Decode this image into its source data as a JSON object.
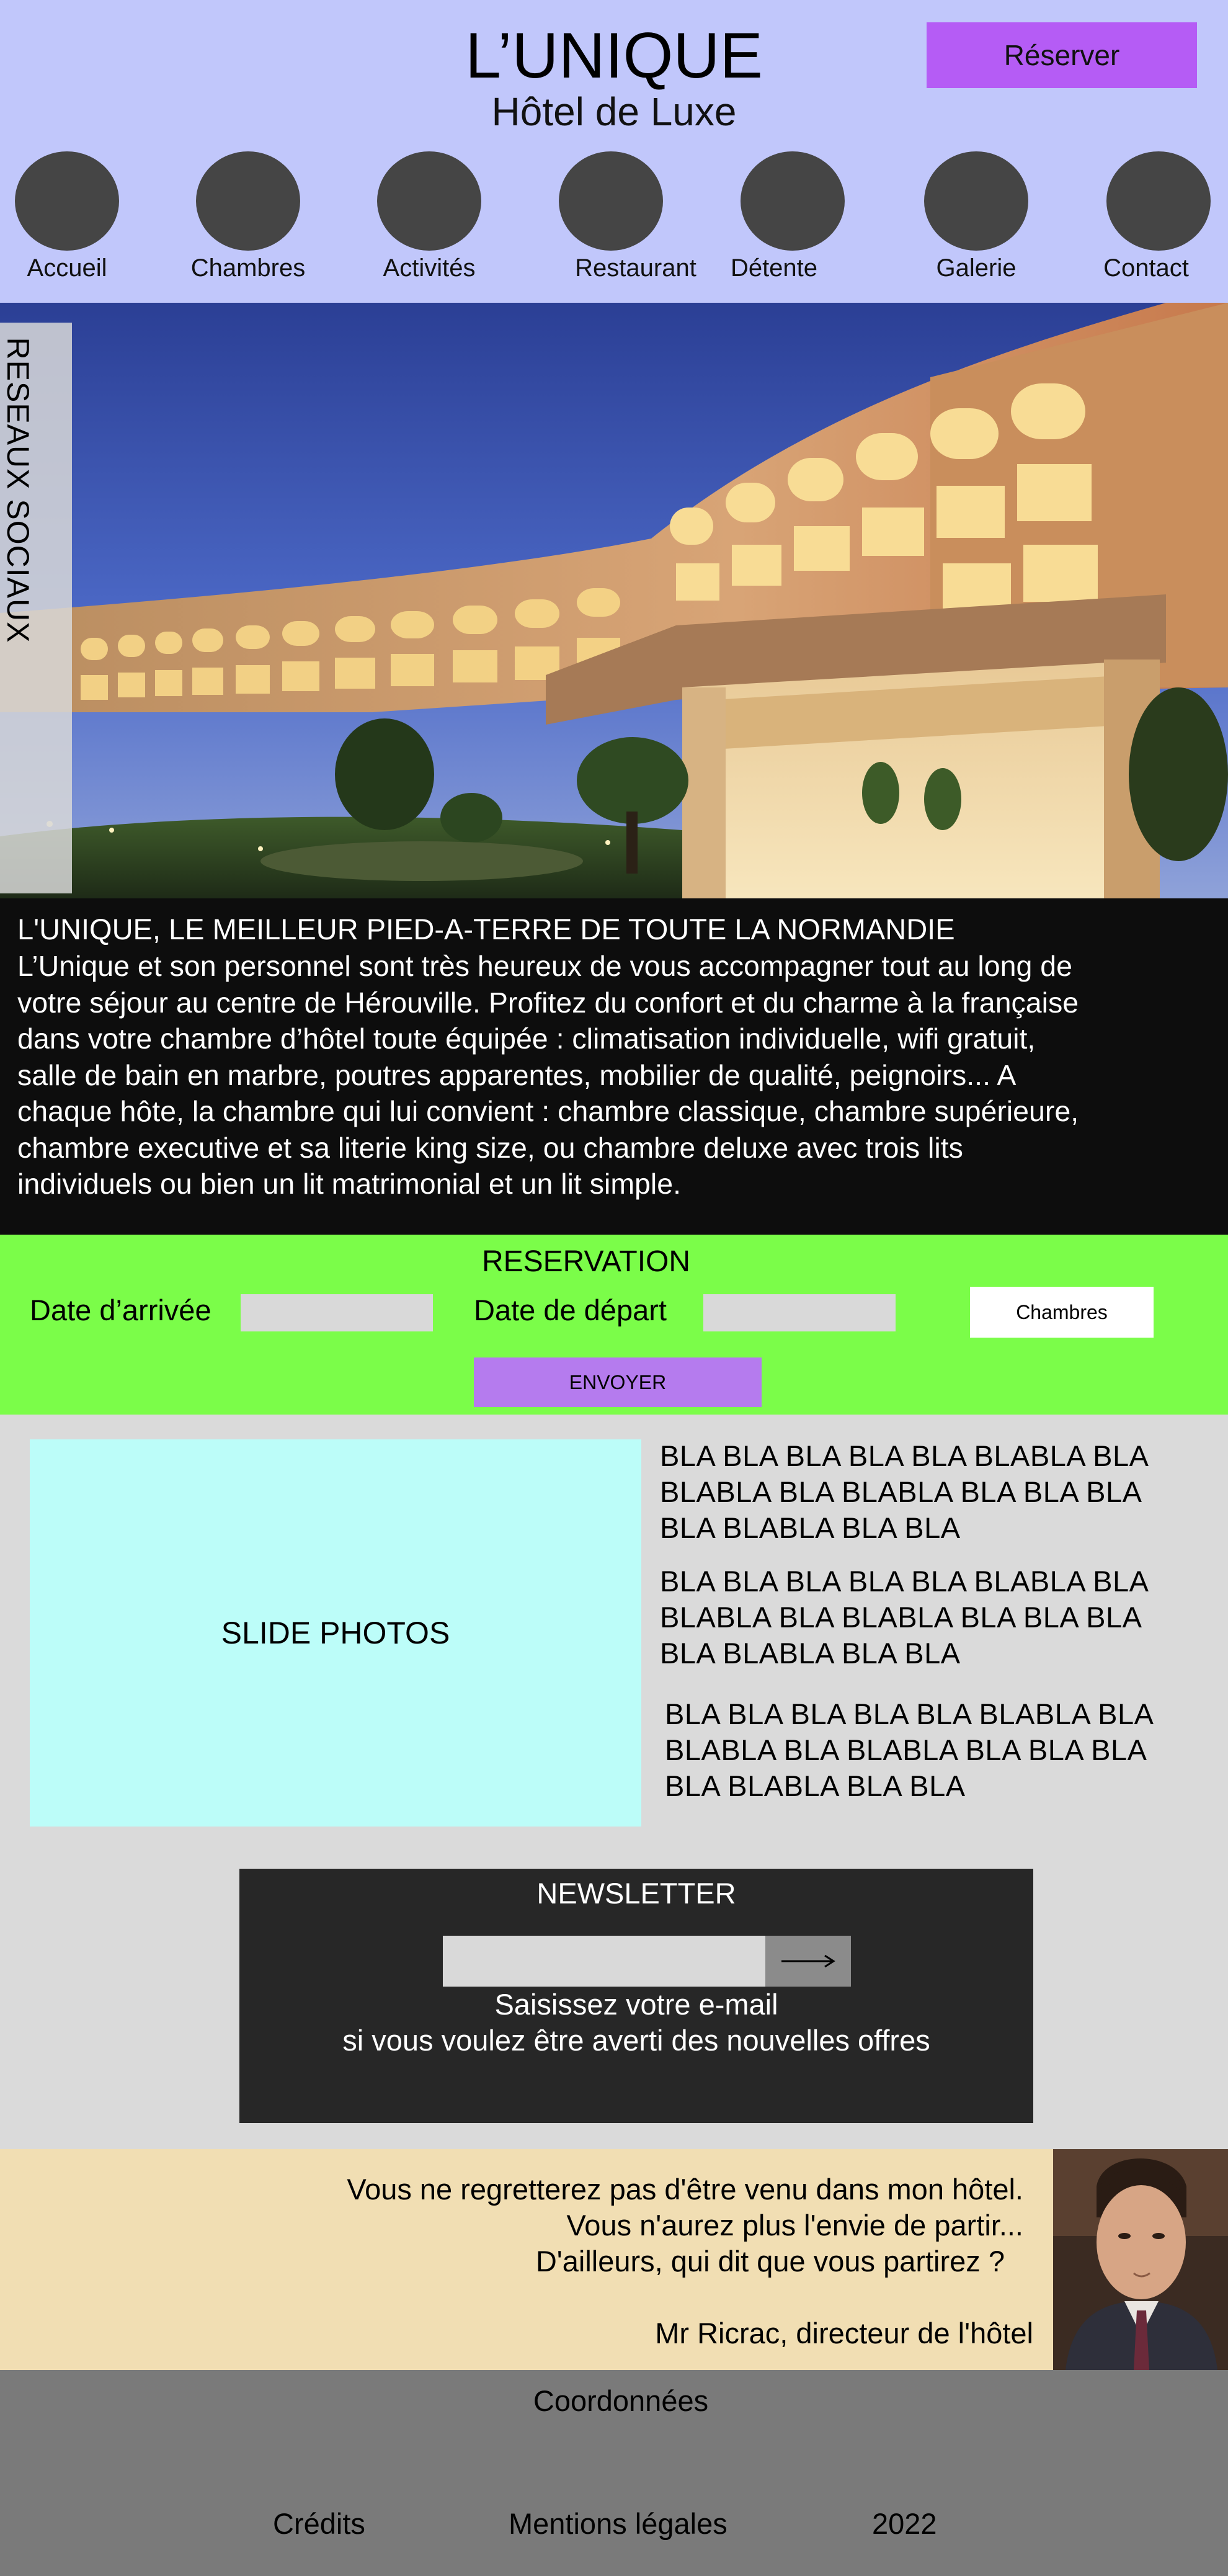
{
  "header": {
    "brand": "L’UNIQUE",
    "subtitle": "Hôtel de Luxe",
    "reserve_label": "Réserver",
    "nav": [
      {
        "label": "Accueil"
      },
      {
        "label": "Chambres"
      },
      {
        "label": "Activités"
      },
      {
        "label": "Restaurant"
      },
      {
        "label": "Détente"
      },
      {
        "label": "Galerie"
      },
      {
        "label": "Contact"
      }
    ]
  },
  "hero": {
    "social_label": "RESEAUX SOCIAUX"
  },
  "intro": {
    "title": "L'UNIQUE, LE MEILLEUR PIED-A-TERRE DE TOUTE LA NORMANDIE",
    "lines": [
      "L’Unique et son personnel sont très heureux de vous accompagner tout au long de",
      "votre séjour au centre de Hérouville. Profitez du confort et du charme à la française",
      "dans votre chambre d’hôtel toute équipée : climatisation individuelle, wifi gratuit,",
      "salle de bain en marbre, poutres apparentes, mobilier de qualité, peignoirs... A",
      "chaque hôte, la chambre qui lui convient : chambre classique, chambre supérieure,",
      "chambre executive et sa literie king size, ou chambre deluxe avec trois lits",
      "individuels ou bien un lit matrimonial et un lit simple."
    ]
  },
  "reservation": {
    "title": "RESERVATION",
    "arrival_label": "Date d’arrivée",
    "arrival_value": "",
    "departure_label": "Date de départ",
    "departure_value": "",
    "rooms_label": "Chambres",
    "send_label": "ENVOYER"
  },
  "content": {
    "slide_label": "SLIDE PHOTOS",
    "paragraphs": [
      [
        "BLA BLA BLA BLA BLA BLABLA BLA",
        "BLABLA BLA BLABLA BLA BLA BLA",
        "BLA BLABLA BLA BLA"
      ],
      [
        "BLA BLA BLA BLA BLA BLABLA BLA",
        "BLABLA BLA BLABLA BLA BLA BLA",
        "BLA BLABLA BLA BLA"
      ],
      [
        "BLA BLA BLA BLA BLA BLABLA BLA",
        "BLABLA BLA BLABLA BLA BLA BLA",
        "BLA BLABLA BLA BLA"
      ]
    ]
  },
  "newsletter": {
    "title": "NEWSLETTER",
    "email_value": "",
    "submit_icon": "arrow-right-icon",
    "line1": "Saisissez votre e-mail",
    "line2": "si vous voulez être averti des nouvelles offres"
  },
  "quote": {
    "lines": [
      "Vous ne regretterez pas d'être venu dans mon hôtel.",
      "Vous n'aurez plus l'envie de partir...",
      "D'ailleurs, qui dit que vous partirez ?"
    ],
    "signature": "Mr Ricrac, directeur de l'hôtel"
  },
  "footer": {
    "coordinates": "Coordonnées",
    "credits": "Crédits",
    "legal": "Mentions légales",
    "year": "2022"
  },
  "colors": {
    "header_bg": "#c1c7fb",
    "accent_purple": "#b55cf5",
    "reservation_bg": "#7bfd49",
    "slide_bg": "#bcfdf9",
    "quote_bg": "#f1deb3",
    "footer_bg": "#7a7a7a"
  }
}
